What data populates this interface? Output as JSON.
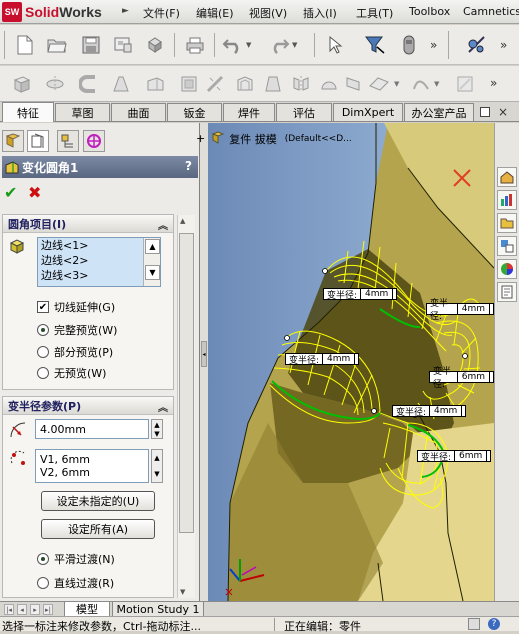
{
  "app": {
    "brand_prefix": "Solid",
    "brand_suffix": "Works",
    "brand_mark": "SW"
  },
  "menu": [
    "文件(F)",
    "编辑(E)",
    "视图(V)",
    "插入(I)",
    "工具(T)",
    "Toolbox",
    "Camnetics"
  ],
  "command_tabs": [
    "特征",
    "草图",
    "曲面",
    "钣金",
    "焊件",
    "评估",
    "DimXpert",
    "办公室产品"
  ],
  "property_manager": {
    "title": "变化圆角1",
    "help": "?",
    "fillet_items": {
      "header": "圆角项目(I)",
      "edges": [
        "边线<1>",
        "边线<2>",
        "边线<3>"
      ],
      "tangent_propagation": {
        "label": "切线延伸(G)",
        "checked": true
      },
      "preview_options": [
        {
          "label": "完整预览(W)",
          "selected": true
        },
        {
          "label": "部分预览(P)",
          "selected": false
        },
        {
          "label": "无预览(W)",
          "selected": false
        }
      ]
    },
    "variable_radius": {
      "header": "变半径参数(P)",
      "radius_value": "4.00mm",
      "vertices": [
        "V1, 6mm",
        "V2, 6mm"
      ],
      "set_unassigned_button": "设定未指定的(U)",
      "set_all_button": "设定所有(A)",
      "transition_options": [
        {
          "label": "平滑过渡(N)",
          "selected": true
        },
        {
          "label": "直线过渡(R)",
          "selected": false
        }
      ]
    }
  },
  "graphics": {
    "tree_path": "复件 拔模",
    "config_label": "(Default<<D...",
    "radius_callouts": [
      {
        "label": "变半径:",
        "value": "4mm"
      },
      {
        "label": "变半径:",
        "value": "4mm"
      },
      {
        "label": "变半径:",
        "value": "4mm"
      },
      {
        "label": "变半径:",
        "value": "6mm"
      },
      {
        "label": "变半径:",
        "value": "4mm"
      },
      {
        "label": "变半径:",
        "value": "6mm"
      }
    ]
  },
  "bottom_tabs": [
    "模型",
    "Motion Study 1"
  ],
  "status": {
    "hint": "选择一标注来修改参数，Ctrl-拖动标注...",
    "mode": "正在编辑：零件"
  },
  "colors": {
    "part_face": "#b2a04e",
    "part_dark": "#5a5216",
    "preview_yellow": "#ffff00",
    "selected_edge": "#00c000",
    "pm_header": "#6c7892"
  }
}
